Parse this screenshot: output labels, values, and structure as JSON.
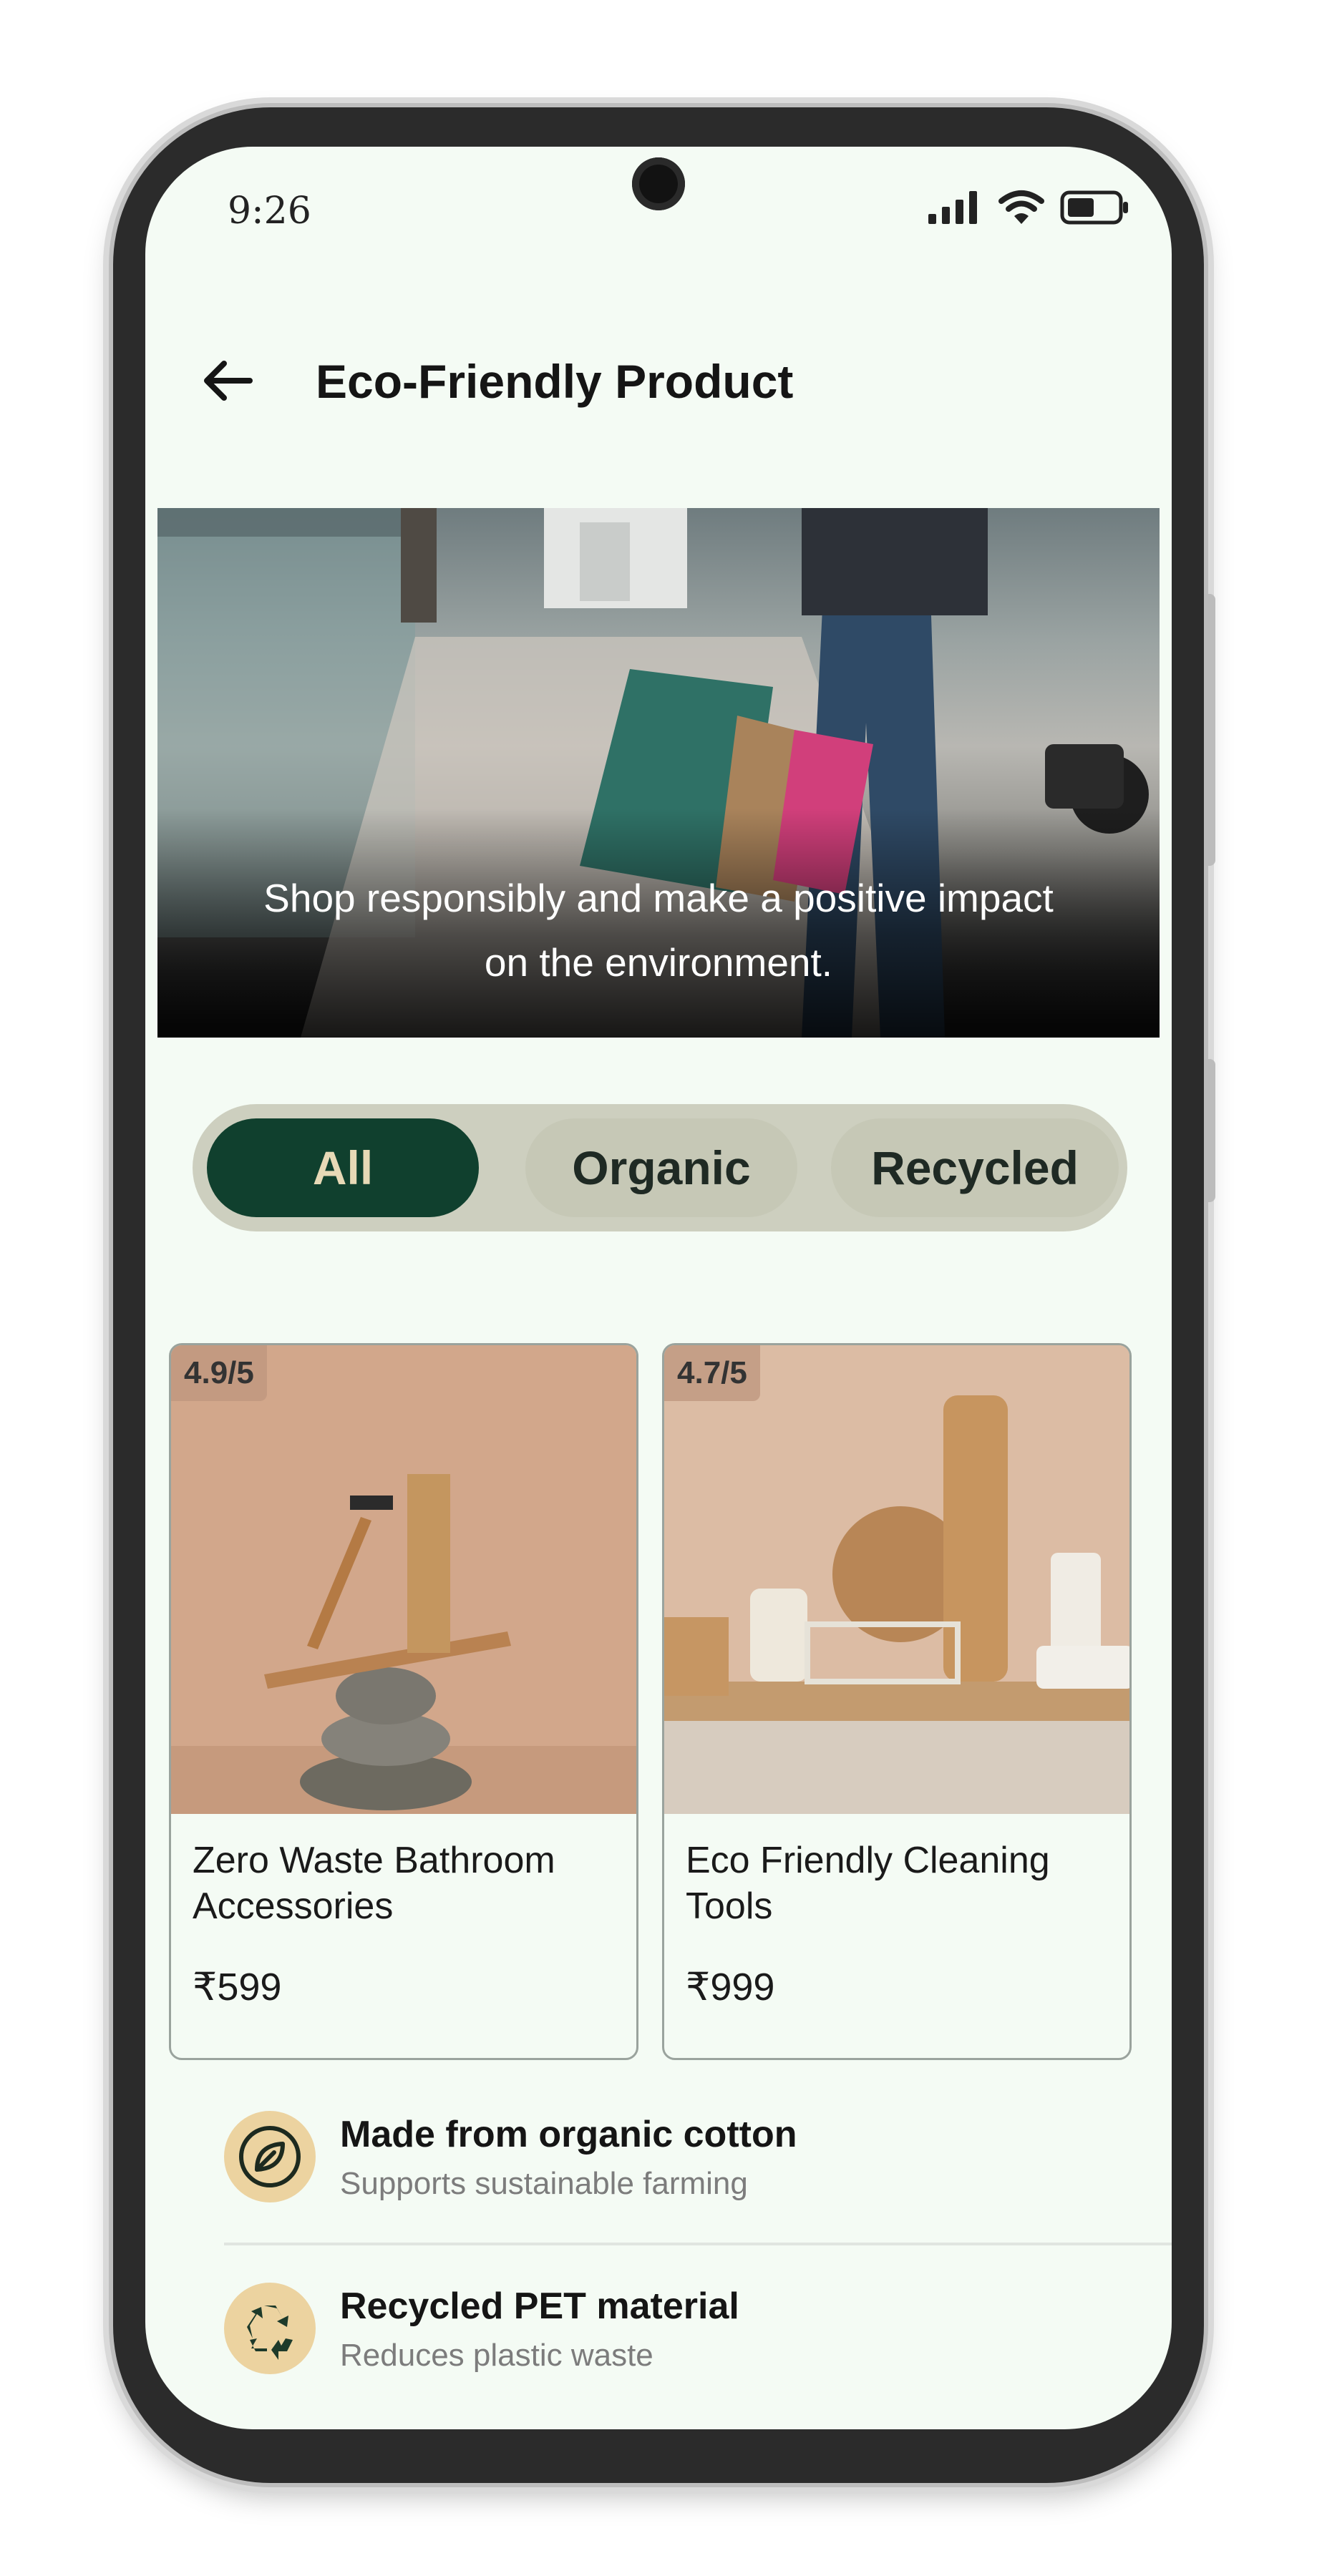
{
  "status_bar": {
    "time": "9:26",
    "icons": [
      "signal-icon",
      "wifi-icon",
      "battery-icon"
    ]
  },
  "header": {
    "back_icon": "arrow-left-icon",
    "title": "Eco-Friendly Product"
  },
  "hero": {
    "caption": "Shop responsibly and make a positive impact on the environment."
  },
  "filters": {
    "items": [
      {
        "label": "All",
        "selected": true
      },
      {
        "label": "Organic",
        "selected": false
      },
      {
        "label": "Recycled",
        "selected": false
      }
    ]
  },
  "products": [
    {
      "rating": "4.9/5",
      "name": "Zero Waste Bathroom Accessories",
      "price": "₹599"
    },
    {
      "rating": "4.7/5",
      "name": "Eco Friendly Cleaning Tools",
      "price": "₹999"
    }
  ],
  "features": [
    {
      "icon": "leaf-icon",
      "title": "Made from organic cotton",
      "subtitle": "Supports sustainable farming"
    },
    {
      "icon": "recycle-icon",
      "title": "Recycled PET material",
      "subtitle": "Reduces plastic waste"
    }
  ],
  "colors": {
    "background": "#f4fbf4",
    "accent_dark_green": "#10402e",
    "chip_text_active": "#e7d9b6",
    "chip_track": "#cdcfbf",
    "feature_icon_bg": "#ecd3a0"
  }
}
